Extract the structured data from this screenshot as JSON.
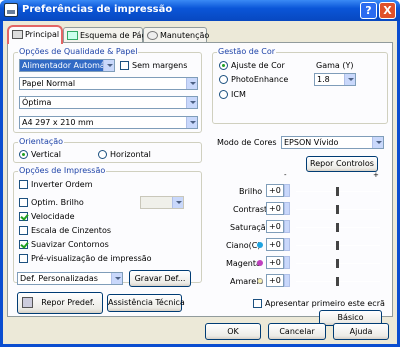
{
  "window": {
    "title": "Preferências de impressão",
    "help": "?",
    "close": "X"
  },
  "tabs": [
    {
      "label": "Principal"
    },
    {
      "label": "Esquema de Página"
    },
    {
      "label": "Manutenção"
    }
  ],
  "quality": {
    "legend": "Opções de Qualidade & Papel",
    "source": "Alimentador Automático",
    "borderless": "Sem margens",
    "media": "Papel Normal",
    "quality": "Óptima",
    "size": "A4 297 x 210 mm"
  },
  "orientation": {
    "legend": "Orientação",
    "vertical": "Vertical",
    "horizontal": "Horizontal"
  },
  "print_options": {
    "legend": "Opções de Impressão",
    "invert": "Inverter Ordem",
    "brightness_opt": "Optim. Brilho",
    "speed": "Velocidade",
    "grayscale": "Escala de Cinzentos",
    "smooth": "Suavizar Contornos",
    "preview": "Pré-visualização de impressão"
  },
  "presets": {
    "value": "Def. Personalizadas",
    "save": "Gravar Def...",
    "reset": "Repor Predef.",
    "support": "Assistência Técnica"
  },
  "color": {
    "legend": "Gestão de Cor",
    "adjust": "Ajuste de Cor",
    "photo": "PhotoEnhance",
    "icm": "ICM",
    "gamma_label": "Gama (Y)",
    "gamma": "1.8",
    "mode_label": "Modo de Cores",
    "mode": "EPSON Vívido",
    "reset": "Repor Controlos"
  },
  "sliders": [
    {
      "label": "Brilho",
      "value": "+0"
    },
    {
      "label": "Contraste",
      "value": "+0"
    },
    {
      "label": "Saturação",
      "value": "+0"
    },
    {
      "label": "Ciano(C)",
      "value": "+0",
      "color": "#1ea3e0"
    },
    {
      "label": "Magenta",
      "value": "+0",
      "color": "#c040c0"
    },
    {
      "label": "Amarelo",
      "value": "+0",
      "color": "#f0f0c0"
    }
  ],
  "scale": {
    "minus": "-",
    "plus": "+"
  },
  "show_first": "Apresentar primeiro este ecrã",
  "basic": "Básico",
  "footer": {
    "ok": "OK",
    "cancel": "Cancelar",
    "help": "Ajuda"
  }
}
